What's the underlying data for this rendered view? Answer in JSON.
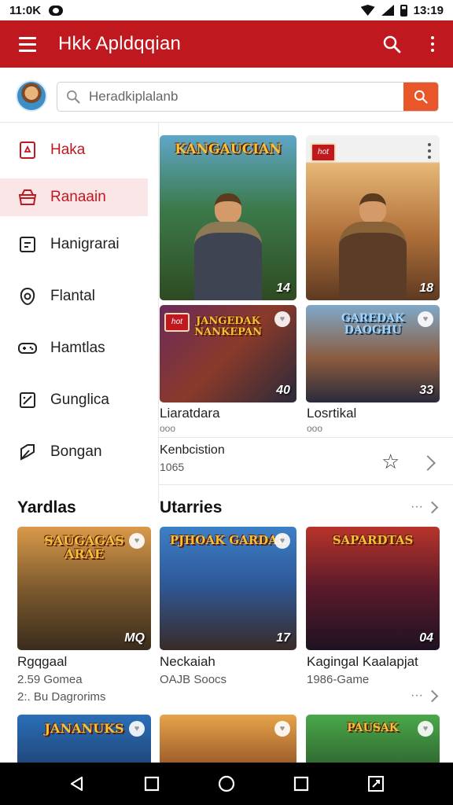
{
  "status_bar": {
    "time": "11:0K",
    "clock_right": "13:19"
  },
  "app_bar": {
    "title": "Hkk Apldqqian"
  },
  "search": {
    "placeholder": "Heradkiplalanb"
  },
  "drawer": {
    "items": [
      {
        "label": "Haka",
        "icon": "gamepad-icon"
      },
      {
        "label": "Ranaain",
        "icon": "store-icon"
      },
      {
        "label": "Hanigrarai",
        "icon": "calendar-icon"
      },
      {
        "label": "Flantal",
        "icon": "shield-icon"
      },
      {
        "label": "Hamtlas",
        "icon": "controller-icon"
      },
      {
        "label": "Gunglica",
        "icon": "chart-icon"
      },
      {
        "label": "Bongan",
        "icon": "flag-icon"
      }
    ]
  },
  "featured": [
    {
      "title_art": "KANGAUCIAN",
      "number": "14"
    },
    {
      "title_art": "",
      "number": "18"
    },
    {
      "title_art": "JANGEDAK NANKEPAN",
      "number": "40",
      "label": "Liaratdara",
      "sub": "ooo"
    },
    {
      "title_art": "GAREDAK DAOGHU",
      "number": "33",
      "label": "Losrtikal",
      "sub": "ooo"
    }
  ],
  "info_row": {
    "title": "Kenbcistion",
    "sub": "1065"
  },
  "sections": {
    "left": "Yardlas",
    "right": "Utarries"
  },
  "cards": [
    {
      "title_art": "SAUGAGAS ARAE",
      "number": "MQ",
      "label": "Rgqgaal",
      "line2": "2.59 Gomea",
      "line3": "2:. Bu Dagrorims"
    },
    {
      "title_art": "PJHOAK GARDAE",
      "number": "17",
      "label": "Neckaiah",
      "line2": "OAJB Soocs"
    },
    {
      "title_art": "SAPARDTAS",
      "number": "04",
      "label": "Kagingal Kaalapjat",
      "line2": "1986-Game"
    }
  ],
  "bottom_cards": [
    {
      "title_art": "JANANUKS"
    },
    {
      "title_art": ""
    },
    {
      "title_art": "PAUSAK"
    }
  ],
  "colors": {
    "primary": "#c0181f",
    "accent": "#e8562a",
    "drawer_active_bg": "#fbe6e7"
  }
}
